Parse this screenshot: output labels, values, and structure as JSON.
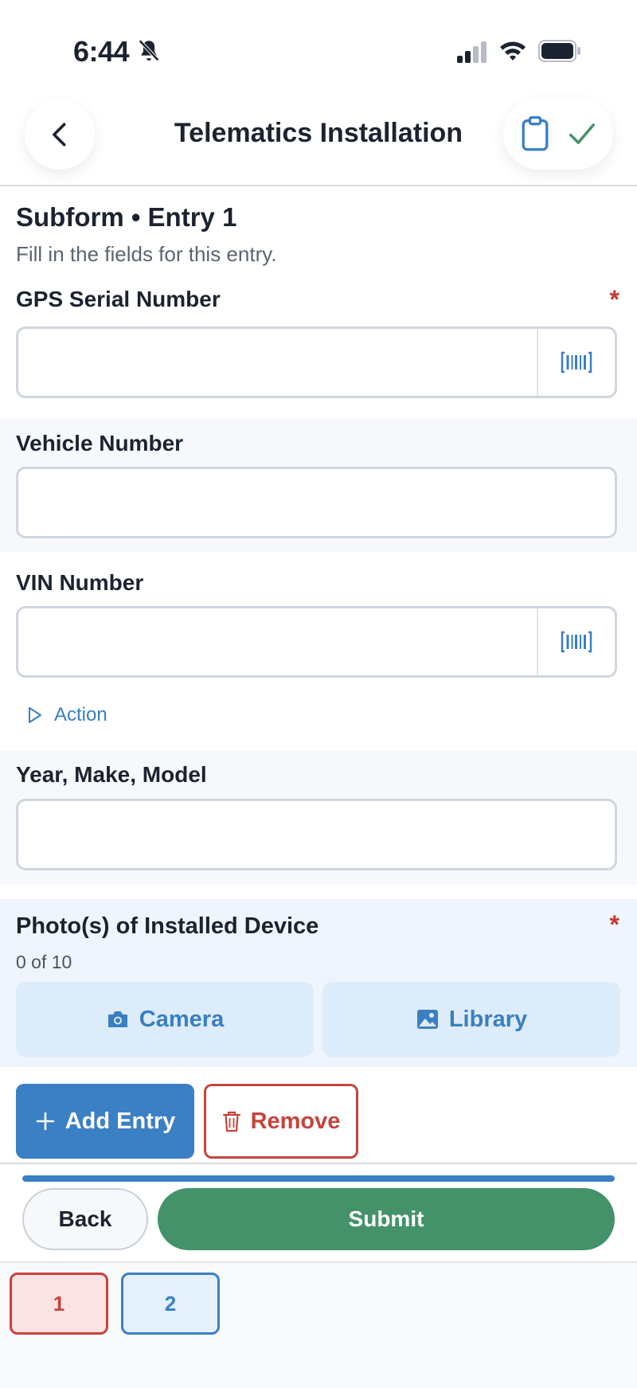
{
  "status_bar": {
    "time": "6:44"
  },
  "header": {
    "title": "Telematics Installation"
  },
  "form": {
    "section_title": "Subform • Entry 1",
    "section_subtitle": "Fill in the fields for this entry.",
    "fields": {
      "gps_serial": {
        "label": "GPS Serial Number",
        "required_marker": "*",
        "value": ""
      },
      "vehicle_number": {
        "label": "Vehicle Number",
        "value": ""
      },
      "vin_number": {
        "label": "VIN Number",
        "value": ""
      },
      "year_make_model": {
        "label": "Year, Make, Model",
        "value": ""
      }
    },
    "action_label": "Action",
    "photos": {
      "label": "Photo(s) of Installed Device",
      "required_marker": "*",
      "count": "0 of 10",
      "camera_label": "Camera",
      "library_label": "Library"
    },
    "add_entry_label": "Add Entry",
    "remove_label": "Remove"
  },
  "footer": {
    "progress": 1.0,
    "back_label": "Back",
    "submit_label": "Submit",
    "pages": [
      "1",
      "2"
    ]
  },
  "colors": {
    "accent": "#3b7fc4",
    "danger": "#c6443c",
    "success": "#43926a"
  }
}
